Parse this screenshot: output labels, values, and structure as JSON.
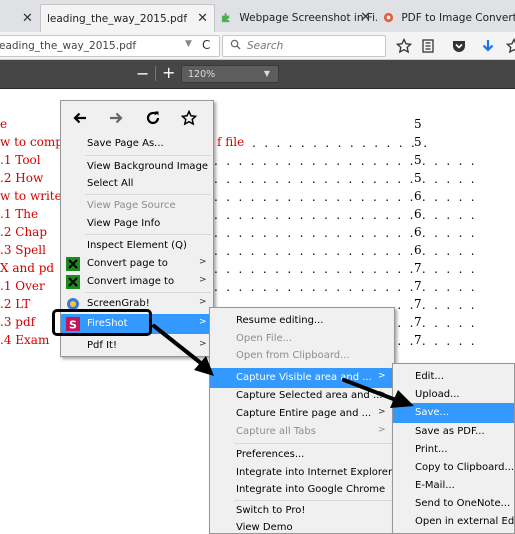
{
  "tabs": [
    {
      "label": "leading_the_way_2015.pdf",
      "active": true
    },
    {
      "label": "Webpage Screenshot in Fi...",
      "active": false
    },
    {
      "label": "PDF to Image Converter",
      "active": false
    }
  ],
  "urlbar": {
    "value": "eading_the_way_2015.pdf"
  },
  "search": {
    "placeholder": "Search"
  },
  "pdf_toolbar": {
    "minus": "−",
    "plus": "+",
    "zoom": "120%"
  },
  "document": {
    "lines": [
      {
        "text": "e",
        "dots": "",
        "page": "5"
      },
      {
        "text": "w to comp",
        "mid": "f file",
        "dots": ". . . . . . . . . . . . . . .",
        "page": "5"
      },
      {
        "text": ".1    Tool",
        "dots": ". . . . . . . . . . . . . . . . . . . . . .",
        "page": "5"
      },
      {
        "text": ".2    How",
        "dots": ". . . . . . . . . . . . . . . . . . . . . .",
        "page": "5"
      },
      {
        "text": "w to write",
        "dots": ". . . . . . . . . . . . . . . . . . . . . .",
        "page": "6"
      },
      {
        "text": ".1    The ",
        "dots": ". . . . . . . . . . . . . . . . . . . . . .",
        "page": "6"
      },
      {
        "text": ".2    Chap",
        "dots": ". . . . . . . . . . . . . . . . . . . . . .",
        "page": "6"
      },
      {
        "text": ".3    Spell",
        "dots": ". . . . . . . . . . . . . . . . . . . . . .",
        "page": "6"
      },
      {
        "text": "X and pd",
        "dots": ". . . . . . . . . . . . . . . . . . . . . .",
        "page": "7"
      },
      {
        "text": ".1    Over",
        "dots": ". . . . . . . . . . . . . . . . . . . . . .",
        "page": "7"
      },
      {
        "text": ".2    LT",
        "dots": ". . . . . . . . . . . . . . . . . . . . . .",
        "page": "7"
      },
      {
        "text": ".3    pdf",
        "dots": ". . . . . . . . . . . . . . . . . . . . . .",
        "page": "7"
      },
      {
        "text": ".4    Exam",
        "dots": ". . . . . . . . . . . . . . . . . . . . . .",
        "page": "7"
      }
    ]
  },
  "context_menu": {
    "items": [
      {
        "label": "Save Page As...",
        "disabled": false
      },
      {
        "label": "View Background Image",
        "disabled": false
      },
      {
        "label": "Select All",
        "disabled": false
      },
      {
        "label": "View Page Source",
        "disabled": true
      },
      {
        "label": "View Page Info",
        "disabled": false
      },
      {
        "label": "Inspect Element (Q)",
        "disabled": false
      },
      {
        "label": "Convert page to",
        "disabled": false
      },
      {
        "label": "Convert image to",
        "disabled": false
      },
      {
        "label": "ScreenGrab!",
        "disabled": false
      },
      {
        "label": "FireShot",
        "disabled": false
      },
      {
        "label": "Pdf It!",
        "disabled": false
      }
    ]
  },
  "fireshot_menu": {
    "items": [
      {
        "label": "Resume editing...",
        "disabled": false
      },
      {
        "label": "Open File...",
        "disabled": true
      },
      {
        "label": "Open from Clipboard...",
        "disabled": true
      },
      {
        "label": "Capture Visible area and ...",
        "disabled": false
      },
      {
        "label": "Capture Selected area and ...",
        "disabled": false
      },
      {
        "label": "Capture Entire page and ...",
        "disabled": false
      },
      {
        "label": "Capture all Tabs",
        "disabled": true
      },
      {
        "label": "Preferences...",
        "disabled": false
      },
      {
        "label": "Integrate into Internet Explorer",
        "disabled": false
      },
      {
        "label": "Integrate into Google Chrome",
        "disabled": false
      },
      {
        "label": "Switch to Pro!",
        "disabled": false
      },
      {
        "label": "View Demo",
        "disabled": false
      }
    ]
  },
  "capture_menu": {
    "items": [
      {
        "label": "Edit...",
        "disabled": false
      },
      {
        "label": "Upload...",
        "disabled": false
      },
      {
        "label": "Save...",
        "disabled": false
      },
      {
        "label": "Save as PDF...",
        "disabled": false
      },
      {
        "label": "Print...",
        "disabled": false
      },
      {
        "label": "Copy to Clipboard...",
        "disabled": false
      },
      {
        "label": "E-Mail...",
        "disabled": false
      },
      {
        "label": "Send to OneNote...",
        "disabled": false
      },
      {
        "label": "Open in external Editor...",
        "disabled": false
      }
    ]
  },
  "colors": {
    "highlight": "#3399ff",
    "doc_red": "#d40000",
    "annotation_outline": "#000000"
  }
}
